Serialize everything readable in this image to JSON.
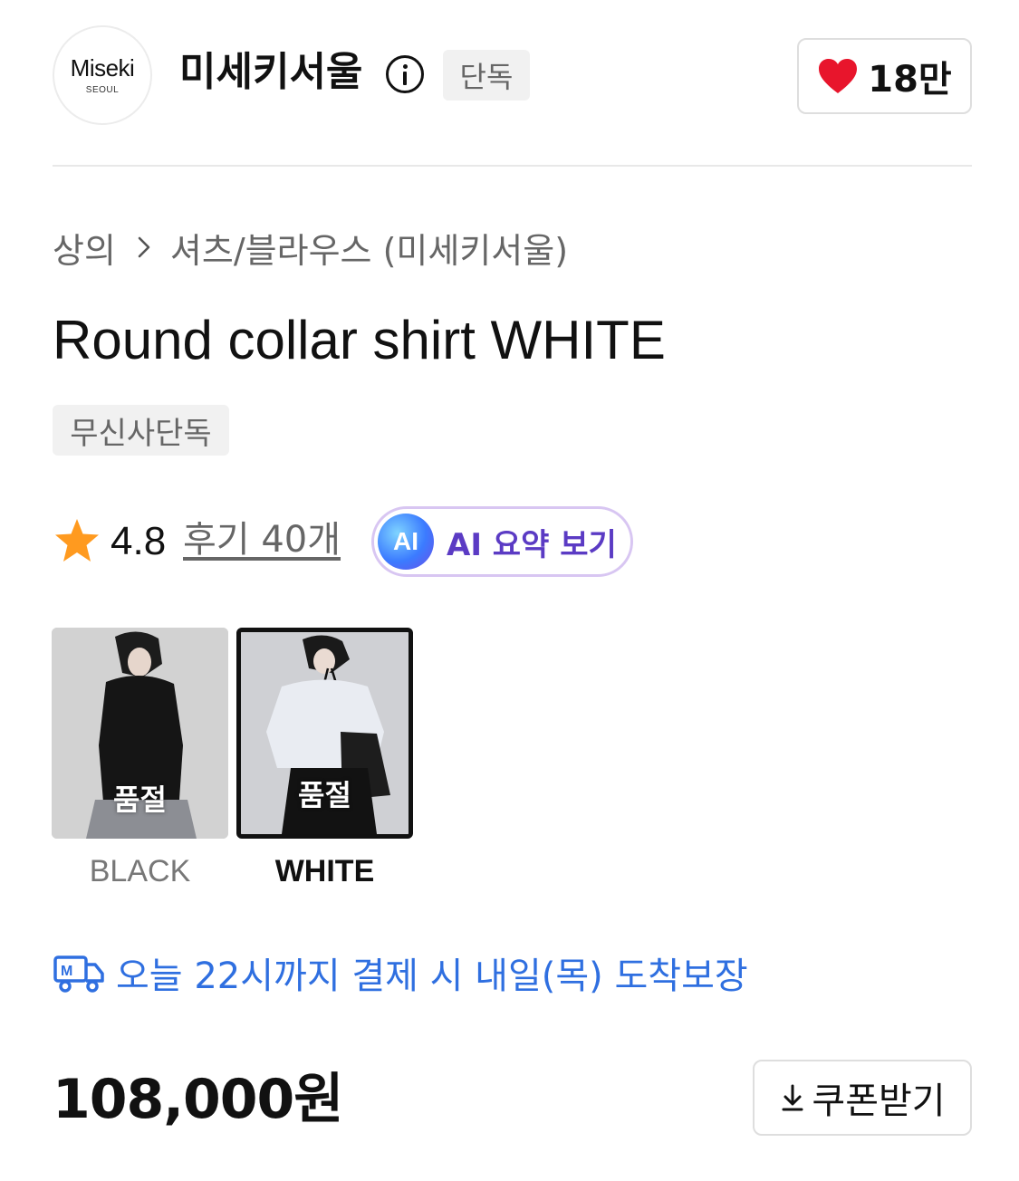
{
  "store": {
    "logo_text": "Miseki",
    "logo_subtext": "SEOUL",
    "name": "미세키서울",
    "exclusive_tag": "단독",
    "like_count": "18만"
  },
  "breadcrumb": {
    "category": "상의",
    "subcategory": "셔츠/블라우스 (미세키서울)"
  },
  "product": {
    "title": "Round collar shirt WHITE",
    "badge": "무신사단독",
    "rating": "4.8",
    "review_link": "후기 40개",
    "ai_badge": "AI",
    "ai_summary_label": "AI 요약 보기"
  },
  "colors": [
    {
      "label": "BLACK",
      "status": "품절",
      "selected": false
    },
    {
      "label": "WHITE",
      "status": "품절",
      "selected": true
    }
  ],
  "delivery": {
    "text": "오늘 22시까지 결제 시 내일(목) 도착보장",
    "icon": "delivery-truck-icon"
  },
  "price": {
    "amount": "108,000원",
    "coupon_label": "쿠폰받기"
  },
  "theme": {
    "accent_blue": "#2f6fe0",
    "heart_red": "#e8152c",
    "star_orange": "#ff9a1f",
    "ai_purple": "#5b3bc4"
  }
}
